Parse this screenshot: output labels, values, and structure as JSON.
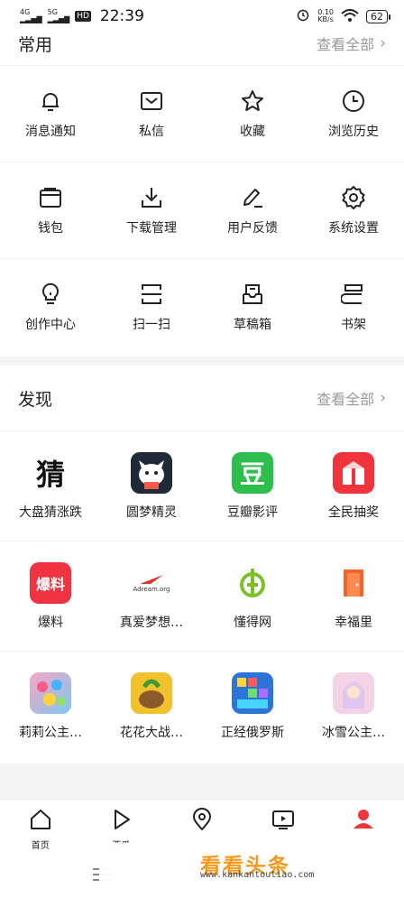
{
  "status_bar": {
    "network_1": "4G",
    "network_2": "5G",
    "hd": "HD",
    "time": "22:39",
    "speed_value": "0.10",
    "speed_unit": "KB/s",
    "battery": "62"
  },
  "common": {
    "title": "常用",
    "view_all": "查看全部",
    "items": [
      {
        "label": "消息通知",
        "icon": "bell-icon"
      },
      {
        "label": "私信",
        "icon": "mail-icon"
      },
      {
        "label": "收藏",
        "icon": "star-icon"
      },
      {
        "label": "浏览历史",
        "icon": "clock-icon"
      },
      {
        "label": "钱包",
        "icon": "wallet-icon"
      },
      {
        "label": "下载管理",
        "icon": "download-icon"
      },
      {
        "label": "用户反馈",
        "icon": "edit-icon"
      },
      {
        "label": "系统设置",
        "icon": "gear-icon"
      },
      {
        "label": "创作中心",
        "icon": "bulb-icon"
      },
      {
        "label": "扫一扫",
        "icon": "scan-icon"
      },
      {
        "label": "草稿箱",
        "icon": "draft-icon"
      },
      {
        "label": "书架",
        "icon": "bookshelf-icon"
      }
    ]
  },
  "discover": {
    "title": "发现",
    "view_all": "查看全部",
    "items": [
      {
        "label": "大盘猜涨跌",
        "icon_text": "猜",
        "color": "#ffffff"
      },
      {
        "label": "圆梦精灵",
        "color": "#1f2a36"
      },
      {
        "label": "豆瓣影评",
        "icon_text": "豆",
        "color": "#2dbe4e"
      },
      {
        "label": "全民抽奖",
        "color": "#f0343c"
      },
      {
        "label": "爆料",
        "icon_text": "爆料",
        "color": "#f03340"
      },
      {
        "label": "真爱梦想…",
        "icon_text": "Adream.org",
        "color": "#ffffff"
      },
      {
        "label": "懂得网",
        "color": "#ffffff"
      },
      {
        "label": "幸福里",
        "color": "#f2652d"
      },
      {
        "label": "莉莉公主…",
        "color": "#e8a9c8"
      },
      {
        "label": "花花大战…",
        "color": "#f2c12c"
      },
      {
        "label": "正经俄罗斯",
        "color": "#2c74d8"
      },
      {
        "label": "冰雪公主…",
        "color": "#f3d3e6"
      }
    ]
  },
  "tabbar": {
    "tabs": [
      {
        "label": "首页",
        "icon": "home-icon"
      },
      {
        "label": "西瓜",
        "icon": "play-icon"
      },
      {
        "label": "",
        "icon": "location-icon"
      },
      {
        "label": "",
        "icon": "tv-icon"
      },
      {
        "label": "",
        "icon": "profile-icon"
      }
    ]
  },
  "watermark": {
    "main": "看看头条",
    "sub": "www.kankantoutiao.com"
  },
  "colors": {
    "accent_red": "#f0343c",
    "watermark_orange": "#f39a1e",
    "watermark_dark": "#222222"
  }
}
